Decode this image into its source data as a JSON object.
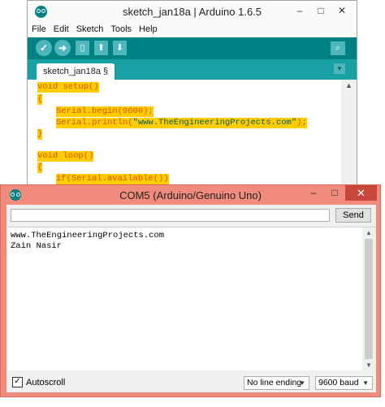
{
  "ide": {
    "title": "sketch_jan18a | Arduino 1.6.5",
    "window_controls": [
      "–",
      "□",
      "✕"
    ],
    "menu": [
      "File",
      "Edit",
      "Sketch",
      "Tools",
      "Help"
    ],
    "toolbar": {
      "verify_icon": "check-icon",
      "upload_icon": "arrow-right-icon",
      "new_icon": "document-icon",
      "open_icon": "arrow-up-icon",
      "save_icon": "arrow-down-icon",
      "serial_monitor_icon": "magnifier-icon"
    },
    "tab_label": "sketch_jan18a §",
    "code": {
      "l1": "void setup()",
      "l2": "{",
      "l3a": "Serial.begin(9600);",
      "l4a": "Serial.println(",
      "l4b": "\"www.TheEngineeringProjects.com\"",
      "l4c": ");",
      "l5": "}",
      "l7": "void loop()",
      "l8": "{",
      "l9": "if(Serial.available())"
    },
    "colors": {
      "teal": "#008184",
      "highlight": "#ffcc00"
    }
  },
  "serial": {
    "title": "COM5 (Arduino/Genuino Uno)",
    "window_controls": [
      "–",
      "□",
      "✕"
    ],
    "input_value": "",
    "send_label": "Send",
    "output": [
      "www.TheEngineeringProjects.com",
      "Zain Nasir"
    ],
    "autoscroll_label": "Autoscroll",
    "autoscroll_checked": true,
    "line_ending": "No line ending",
    "baud": "9600 baud",
    "colors": {
      "titlebar": "#f18b7e",
      "close": "#c7473a"
    }
  }
}
